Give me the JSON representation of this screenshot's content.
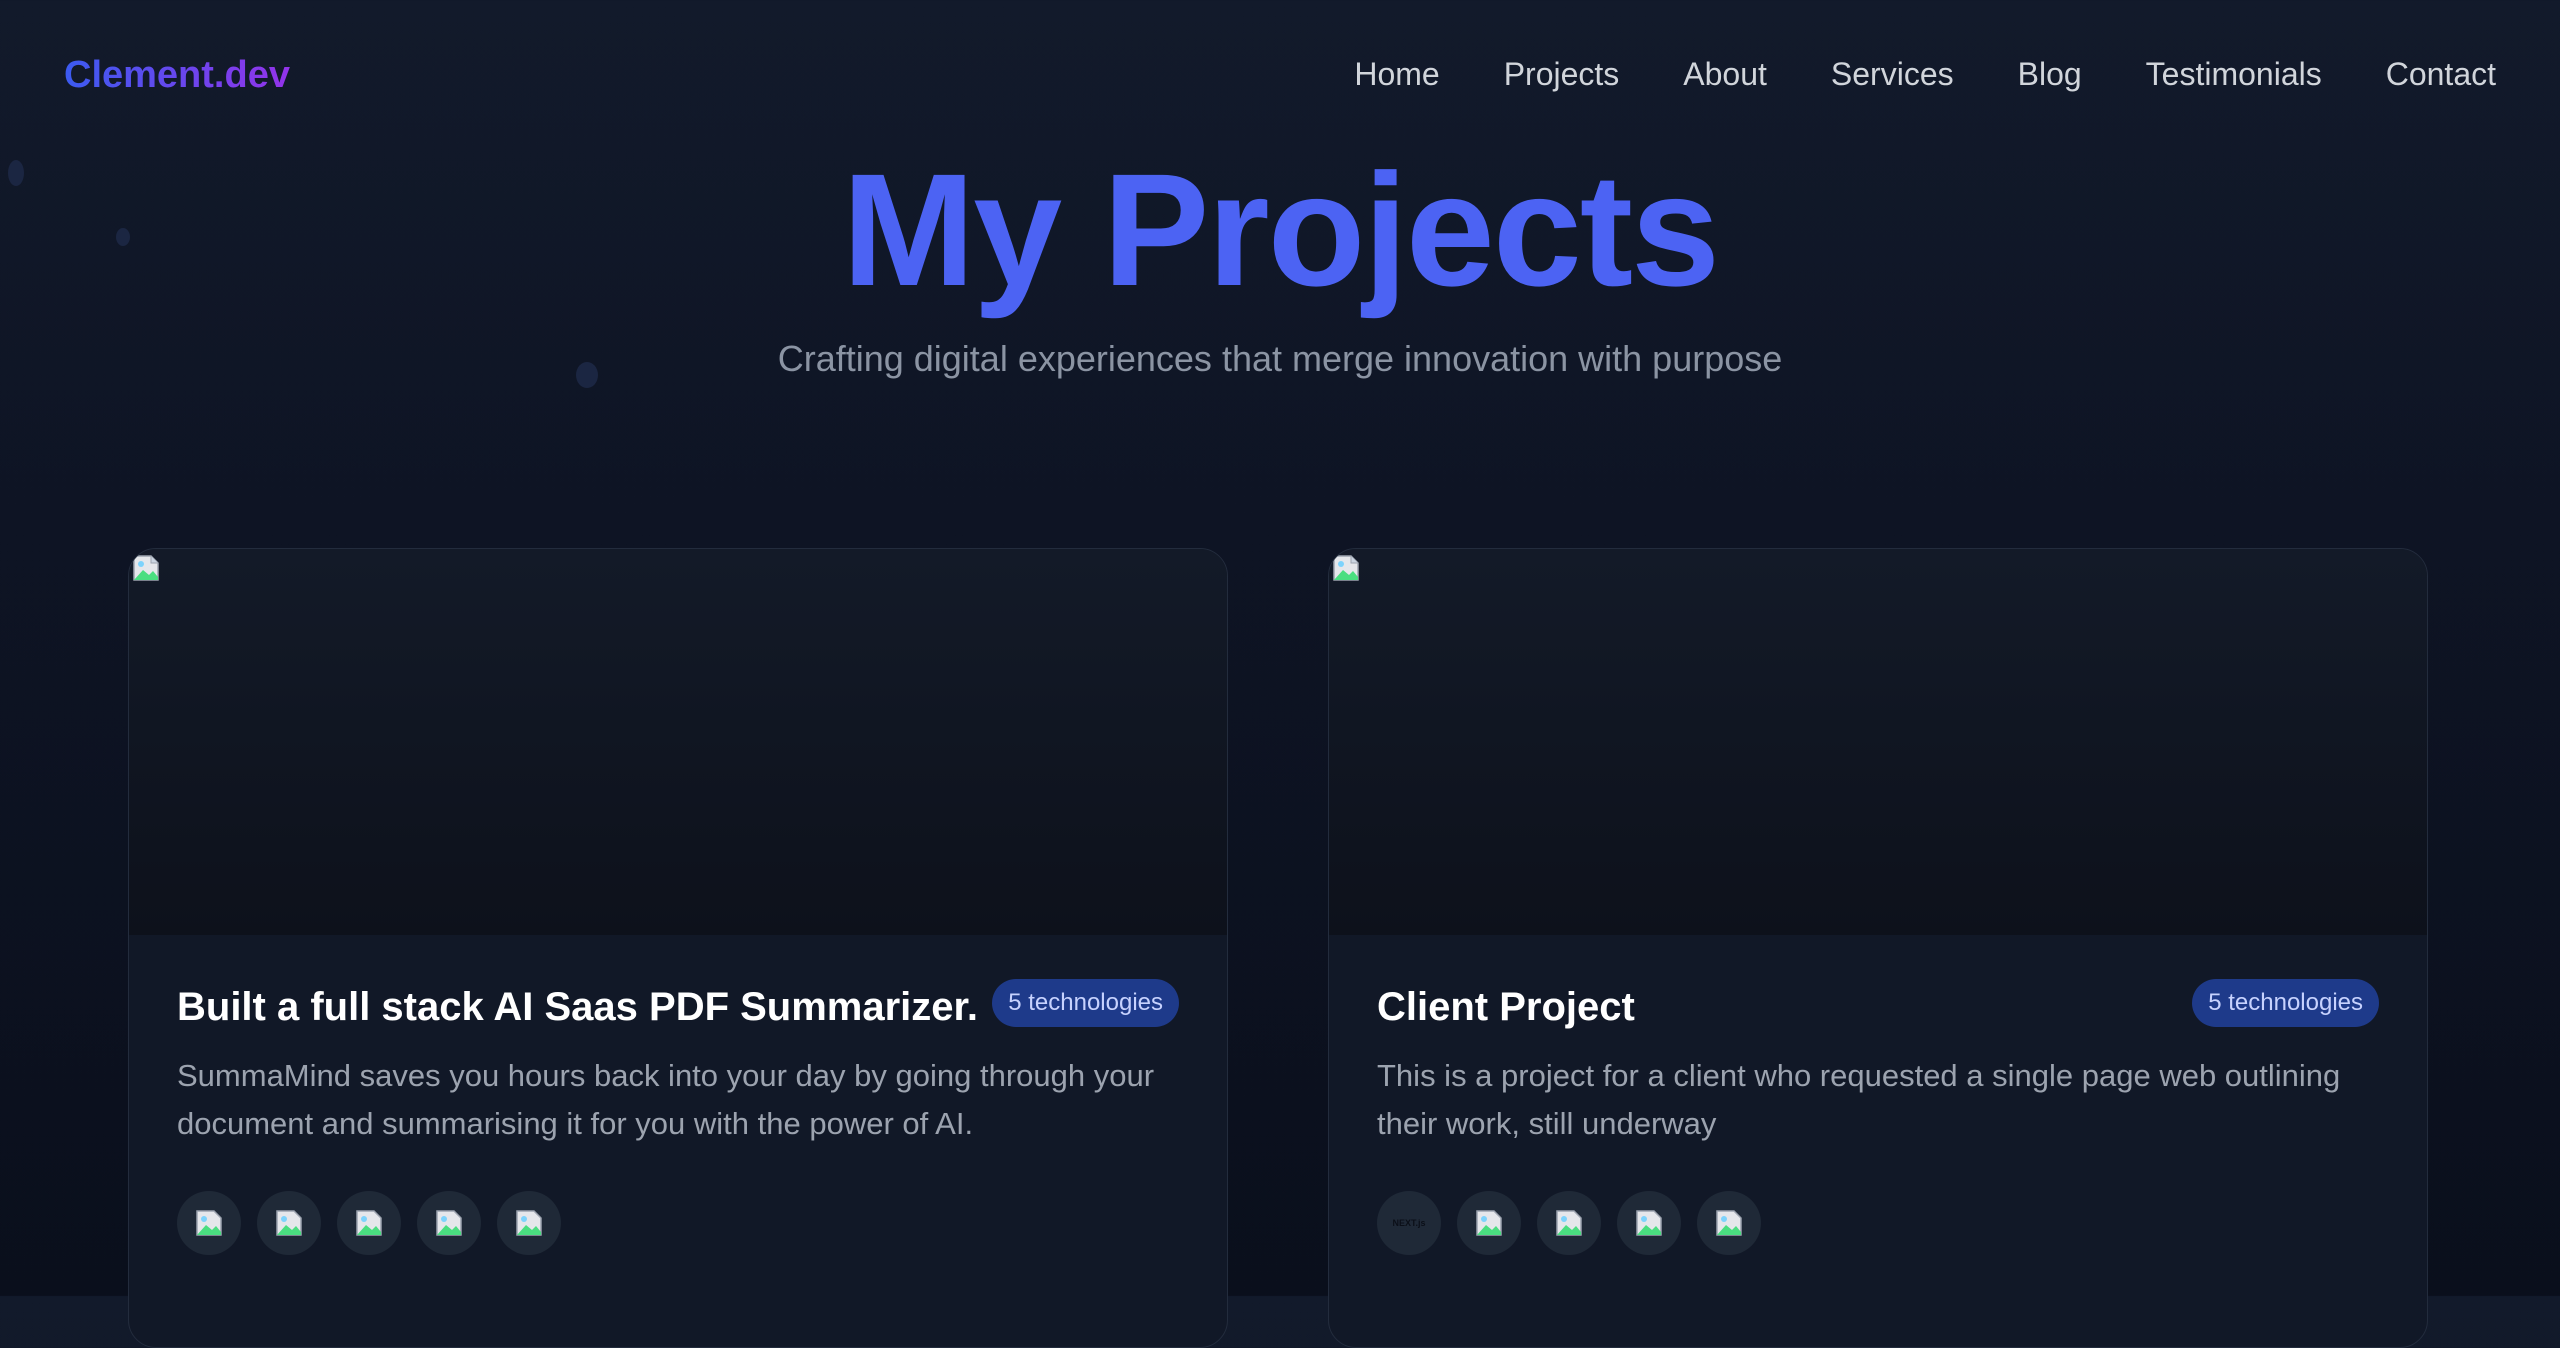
{
  "logo": "Clement.dev",
  "nav": [
    "Home",
    "Projects",
    "About",
    "Services",
    "Blog",
    "Testimonials",
    "Contact"
  ],
  "hero": {
    "title": "My Projects",
    "subtitle": "Crafting digital experiences that merge innovation with purpose"
  },
  "projects": [
    {
      "title": "Built a full stack AI Saas PDF Summarizer.",
      "badge": "5 technologies",
      "description": "SummaMind saves you hours back into your day by going through your document and summarising it for you with the power of AI.",
      "tech_icons": [
        "broken-image-icon",
        "broken-image-icon",
        "broken-image-icon",
        "broken-image-icon",
        "broken-image-icon"
      ]
    },
    {
      "title": "Client Project",
      "badge": "5 technologies",
      "description": "This is a project for a client who requested a single page web outlining their work, still underway",
      "tech_icons": [
        "nextjs-icon",
        "broken-image-icon",
        "broken-image-icon",
        "broken-image-icon",
        "broken-image-icon"
      ],
      "first_icon_text": "NEXT.js"
    }
  ],
  "colors": {
    "accent": "#4c63f3",
    "logo_gradient_start": "#3b5bf0",
    "logo_gradient_end": "#9333ea",
    "badge_bg": "#1e3a8a",
    "card_bg": "#111827"
  }
}
